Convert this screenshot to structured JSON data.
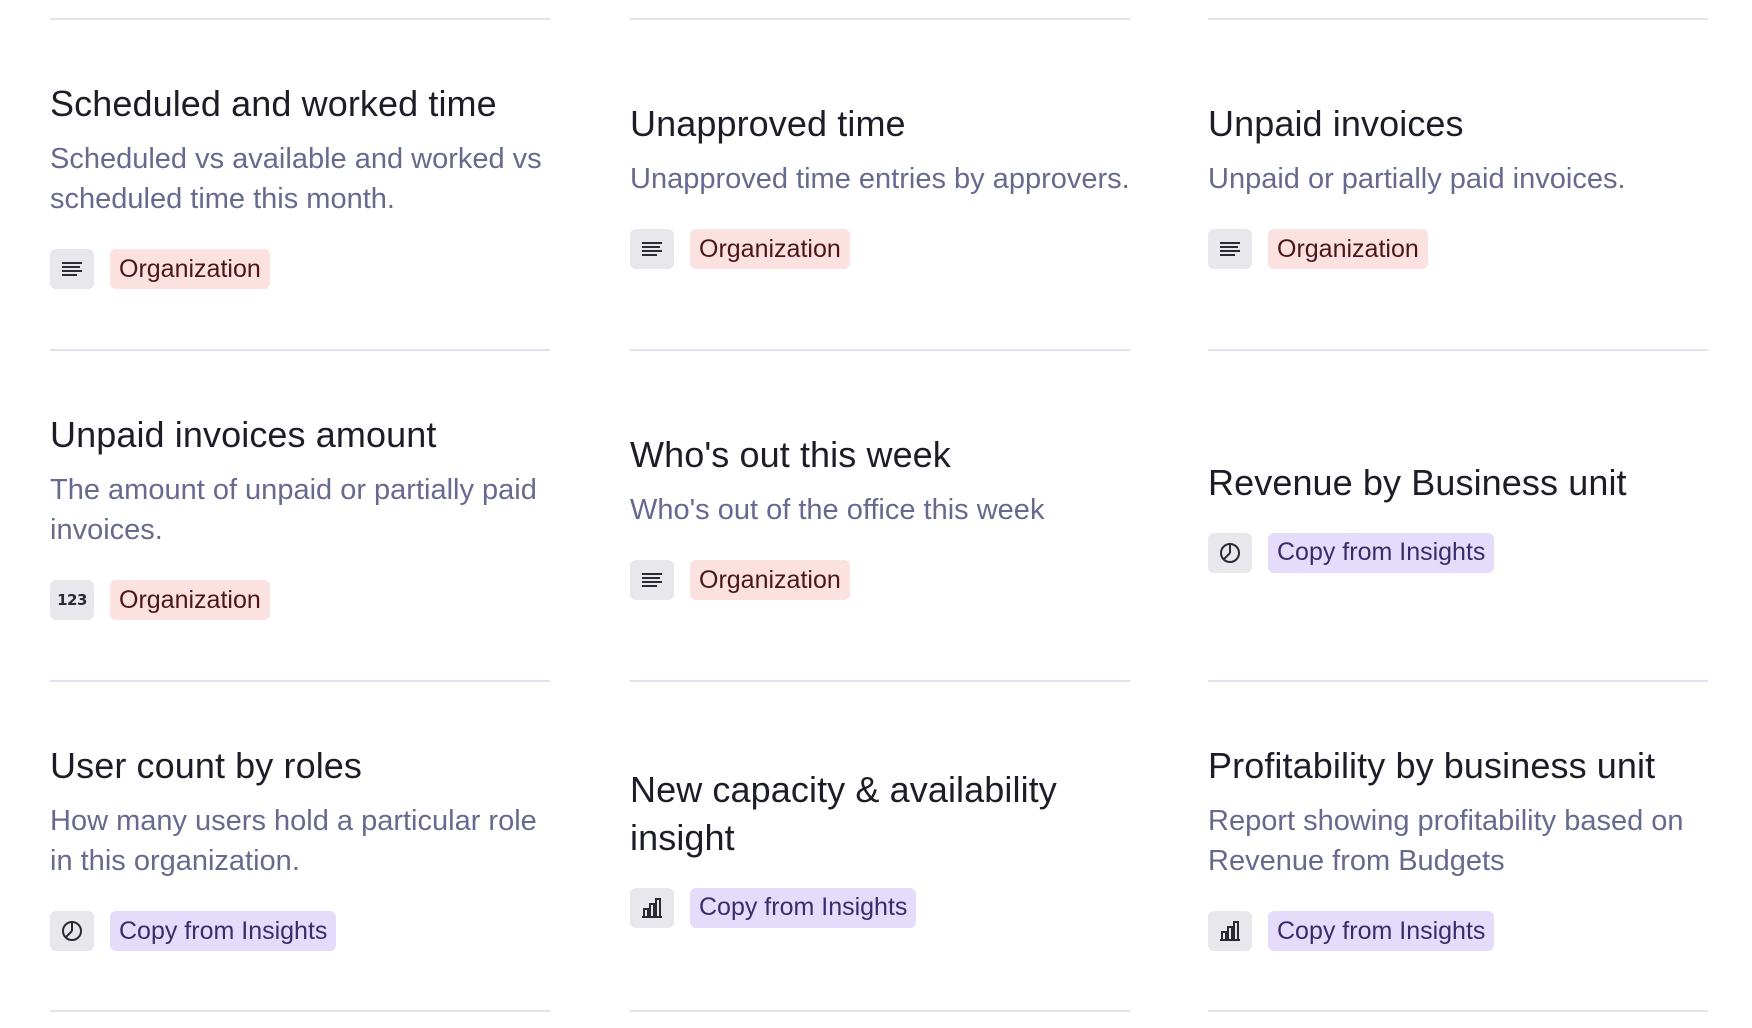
{
  "cards": [
    {
      "title": "Scheduled and worked time",
      "description": "Scheduled vs available and worked vs scheduled time this month.",
      "icon": "text-lines-icon",
      "tag": "Organization"
    },
    {
      "title": "Unapproved time",
      "description": "Unapproved time entries by approvers.",
      "icon": "text-lines-icon",
      "tag": "Organization"
    },
    {
      "title": "Unpaid invoices",
      "description": "Unpaid or partially paid invoices.",
      "icon": "text-lines-icon",
      "tag": "Organization"
    },
    {
      "title": "Unpaid invoices amount",
      "description": "The amount of unpaid or partially paid invoices.",
      "icon": "number-icon",
      "icon_text": "123",
      "tag": "Organization"
    },
    {
      "title": "Who's out this week",
      "description": "Who's out of the office this week",
      "icon": "text-lines-icon",
      "tag": "Organization"
    },
    {
      "title": "Revenue by Business unit",
      "description": "",
      "icon": "pie-chart-icon",
      "tag": "Copy from Insights"
    },
    {
      "title": "User count by roles",
      "description": "How many users hold a particular role in this organization.",
      "icon": "pie-chart-icon",
      "tag": "Copy from Insights"
    },
    {
      "title": "New capacity & availability insight",
      "description": "",
      "icon": "bar-chart-icon",
      "tag": "Copy from Insights"
    },
    {
      "title": "Profitability by business unit",
      "description": "Report showing profitability based on Revenue from Budgets",
      "icon": "bar-chart-icon",
      "tag": "Copy from Insights"
    }
  ],
  "colors": {
    "organization_badge_bg": "#fbe1df",
    "insights_badge_bg": "#e5dcfb",
    "description_text": "#676a8f",
    "divider": "#e4e2f0"
  }
}
